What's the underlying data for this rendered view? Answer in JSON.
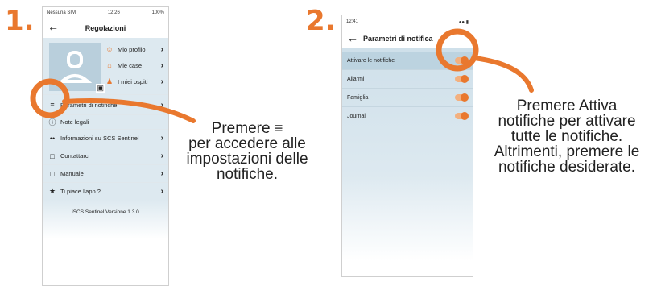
{
  "steps": {
    "step1": "1.",
    "step2": "2."
  },
  "phone1": {
    "status_carrier": "Nessuna SIM",
    "status_time": "12:26",
    "status_battery": "100%",
    "title": "Regolazioni",
    "profile_links": [
      {
        "label": "Mio profilo",
        "icon": "user-icon"
      },
      {
        "label": "Mie case",
        "icon": "house-icon"
      },
      {
        "label": "I miei ospiti",
        "icon": "guests-icon"
      }
    ],
    "menu": [
      {
        "label": "Parametri di notifiche",
        "icon": "sliders-icon"
      },
      {
        "label": "Note legali",
        "icon": "info-icon"
      },
      {
        "label": "Informazioni su SCS Sentinel",
        "icon": "dots-icon"
      },
      {
        "label": "Contattarci",
        "icon": "chat-icon"
      },
      {
        "label": "Manuale",
        "icon": "document-icon"
      },
      {
        "label": "Ti piace l'app ?",
        "icon": "star-icon"
      }
    ],
    "version": "iSCS Sentinel Versione 1.3.0"
  },
  "phone2": {
    "status_time": "12:41",
    "title": "Parametri di notifica",
    "rows": [
      {
        "label": "Attivare le notifiche",
        "on": true
      },
      {
        "label": "Allarmi",
        "on": true
      },
      {
        "label": "Famiglia",
        "on": true
      },
      {
        "label": "Journal",
        "on": true
      }
    ]
  },
  "caption1": {
    "line1": "Premere",
    "line2": "per accedere alle",
    "line3": "impostazioni delle",
    "line4": "notifiche."
  },
  "caption2": {
    "line1": "Premere Attiva",
    "line2": "notifiche per attivare",
    "line3": "tutte le notifiche.",
    "line4": "Altrimenti, premere le",
    "line5": "notifiche desiderate."
  },
  "colors": {
    "accent": "#e9782e",
    "list_bg": "#dde9f0"
  }
}
